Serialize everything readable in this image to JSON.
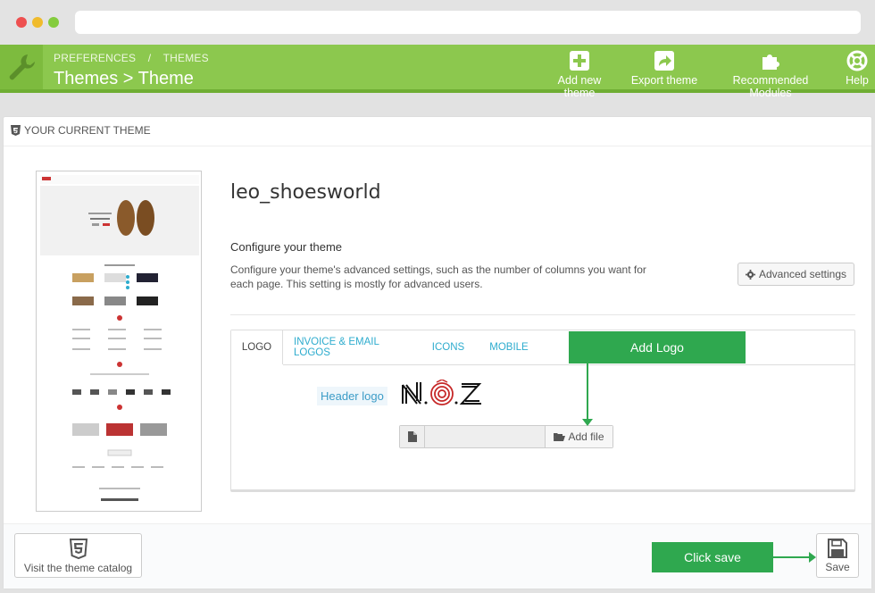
{
  "toolbar": {
    "breadcrumb": [
      "PREFERENCES",
      "/",
      "THEMES"
    ],
    "title": "Themes > Theme",
    "buttons": {
      "add_new_theme": "Add new theme",
      "export_theme": "Export theme",
      "recommended_modules": "Recommended Modules",
      "help": "Help"
    }
  },
  "panel": {
    "heading": "YOUR CURRENT THEME",
    "theme_name": "leo_shoesworld",
    "configure_title": "Configure your theme",
    "configure_desc": "Configure your theme's advanced settings, such as the number of columns you want for each page. This setting is mostly for advanced users.",
    "advanced_button": "Advanced settings"
  },
  "tabs": {
    "items": [
      "LOGO",
      "INVOICE & EMAIL LOGOS",
      "ICONS",
      "MOBILE"
    ],
    "active": "LOGO"
  },
  "logo_tab": {
    "header_logo_label": "Header logo",
    "add_file_button": "Add file"
  },
  "annotations": {
    "add_logo": "Add Logo",
    "click_save": "Click save"
  },
  "footer": {
    "catalog_button": "Visit the theme catalog",
    "save_button": "Save"
  },
  "colors": {
    "toolbar_green": "#8cc84e",
    "callout_green": "#2fa84f",
    "link_blue": "#2eacce"
  }
}
